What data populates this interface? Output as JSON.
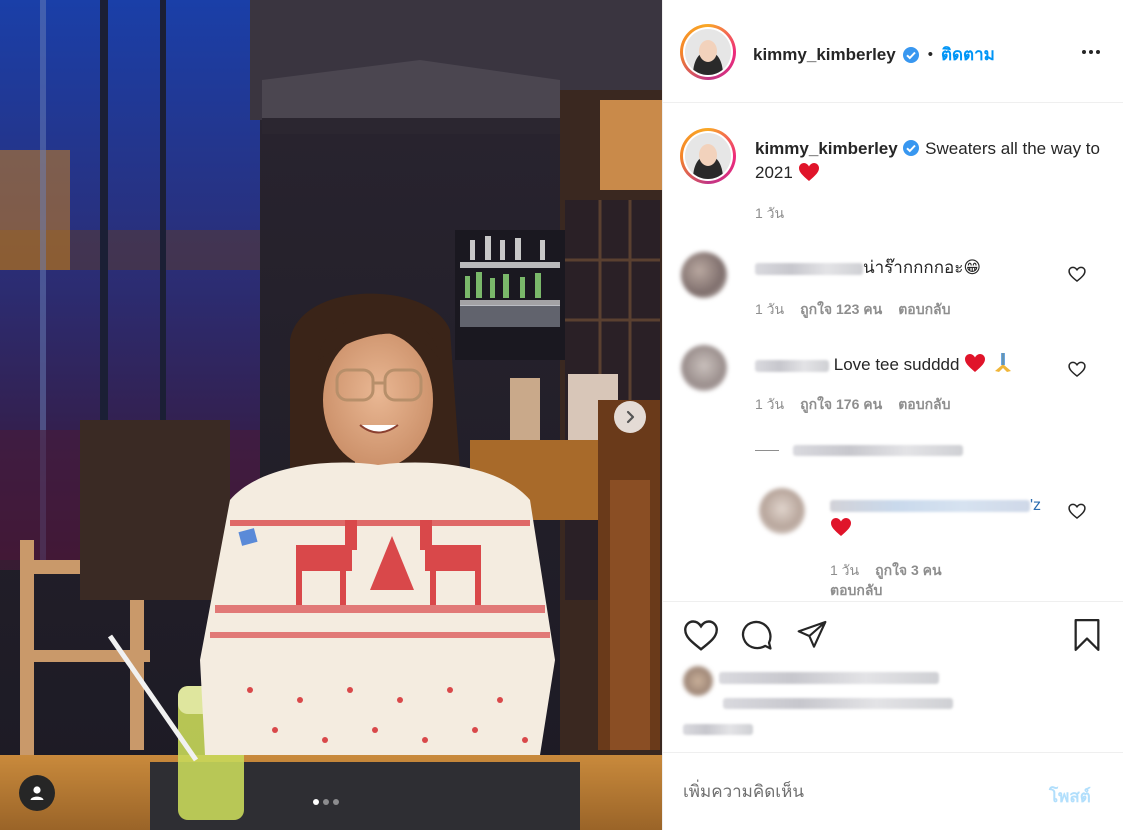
{
  "post": {
    "username": "kimmy_kimberley",
    "follow_separator": "•",
    "follow_label": "ติดตาม",
    "caption": "Sweaters all the way to 2021",
    "caption_emoji": "heart",
    "caption_time": "1 วัน",
    "carousel": {
      "slides": 3,
      "current": 1
    }
  },
  "comments": [
    {
      "text": "น่าร๊ากกกกอะ😁",
      "time": "1 วัน",
      "likes": "ถูกใจ 123 คน",
      "reply": "ตอบกลับ"
    },
    {
      "text": "Love tee sudddd",
      "emoji": "❤️🙏",
      "time": "1 วัน",
      "likes": "ถูกใจ 176 คน",
      "reply": "ตอบกลับ"
    },
    {
      "reply_suffix": "'z",
      "time": "1 วัน",
      "likes": "ถูกใจ 3 คน",
      "reply": "ตอบกลับ"
    }
  ],
  "add_comment": {
    "placeholder": "เพิ่มความคิดเห็น",
    "post_label": "โพสต์"
  },
  "colors": {
    "accent": "#0095f6",
    "post_disabled": "#b2dffc",
    "heart": "#ed4956",
    "muted": "#8e8e8e"
  },
  "icons": [
    "chevron-right-icon",
    "user-tag-icon",
    "more-icon",
    "verified-icon",
    "heart-icon",
    "comment-icon",
    "share-icon",
    "bookmark-icon"
  ]
}
